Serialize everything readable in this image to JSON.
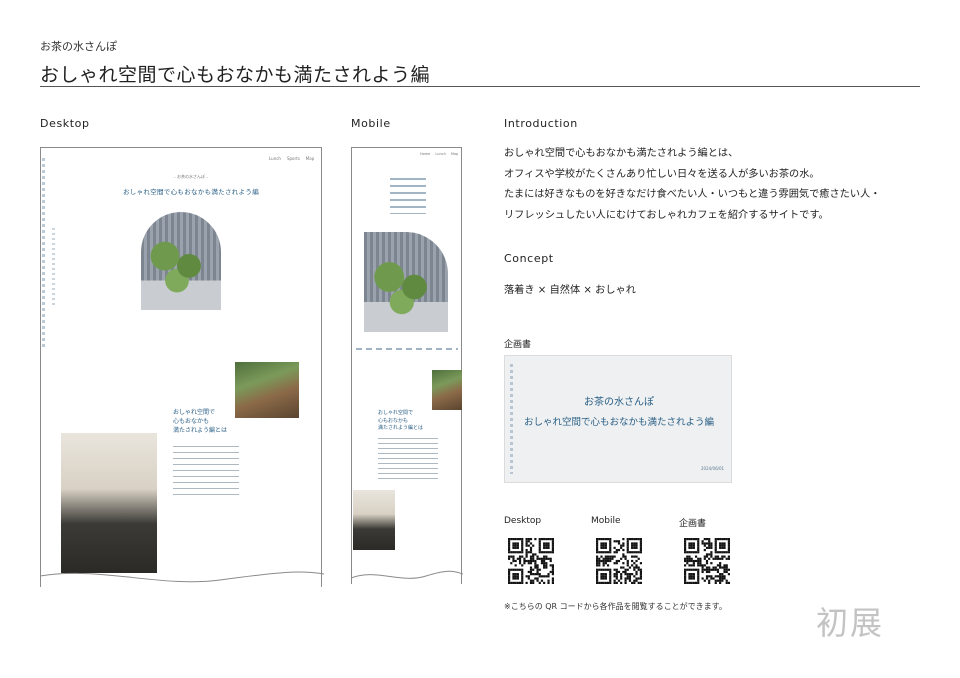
{
  "header": {
    "brand": "お茶の水さんぽ",
    "title": "おしゃれ空間で心もおなかも満たされよう編"
  },
  "sections": {
    "desktop": "Desktop",
    "mobile": "Mobile",
    "introduction": "Introduction",
    "concept": "Concept",
    "proposal": "企画書"
  },
  "introduction": {
    "lines": [
      "おしゃれ空間で心もおなかも満たされよう編とは、",
      "オフィスや学校がたくさんあり忙しい日々を送る人が多いお茶の水。",
      "たまには好きなものを好きなだけ食べたい人・いつもと違う雰囲気で癒さたい人・",
      "リフレッシュしたい人にむけておしゃれカフェを紹介するサイトです。"
    ]
  },
  "concept": {
    "text": "落着き × 自然体 × おしゃれ"
  },
  "proposal_card": {
    "title": "お茶の水さんぽ",
    "subtitle": "おしゃれ空間で心もおなかも満たされよう編",
    "date": "2024/06/01"
  },
  "desktop_mock": {
    "nav": [
      "Lunch",
      "Sports",
      "Map"
    ],
    "hero_small": "– お茶の水さんぽ –",
    "hero_title": "おしゃれ空間で心もおなかも満たされよう編",
    "section_heading": [
      "おしゃれ空間で",
      "心もおなかも",
      "満たされよう編とは"
    ]
  },
  "mobile_mock": {
    "nav": [
      "Home",
      "Lunch",
      "Map"
    ],
    "section_heading": [
      "おしゃれ空間で",
      "心もおなかも",
      "満たされよう編とは"
    ]
  },
  "qr": {
    "labels": [
      "Desktop",
      "Mobile",
      "企画書"
    ]
  },
  "note": "※こちらの QR コードから各作品を閲覧することができます。",
  "stamp": "初展",
  "colors": {
    "accent": "#2a5f86",
    "rule": "#555555",
    "card": "#eef0f1"
  }
}
